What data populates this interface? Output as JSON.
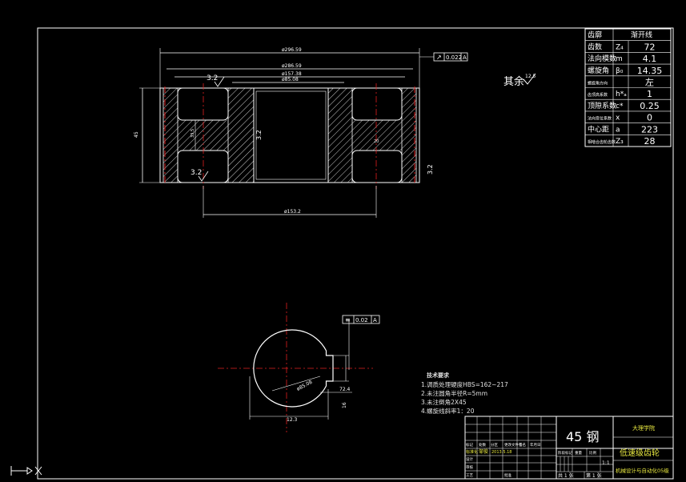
{
  "params_table": {
    "rows": [
      {
        "label": "齿廓",
        "symbol": "",
        "value": "渐开线"
      },
      {
        "label": "齿数",
        "symbol": "Z₄",
        "value": "72"
      },
      {
        "label": "法向模数",
        "symbol": "m",
        "value": "4.1"
      },
      {
        "label": "螺旋角",
        "symbol": "β₀",
        "value": "14.35"
      },
      {
        "label": "螺旋角方向",
        "symbol": "",
        "value": "左"
      },
      {
        "label": "齿顶高系数",
        "symbol": "h*ₐ",
        "value": "1"
      },
      {
        "label": "顶隙系数",
        "symbol": "c*",
        "value": "0.25"
      },
      {
        "label": "法向变位系数",
        "symbol": "x",
        "value": "0"
      },
      {
        "label": "中心距",
        "symbol": "a",
        "value": "223"
      },
      {
        "label": "相啮合齿轮齿数",
        "symbol": "Z₃",
        "value": "28"
      }
    ]
  },
  "surface_note": {
    "text": "其余",
    "roughness": "12.5"
  },
  "section_view": {
    "dims": {
      "top_outer": "ø296.59",
      "top_second": "ø286.59",
      "top_third": "ø157.38",
      "top_bore": "ø85.08",
      "bottom": "ø153.2",
      "left_height": "45",
      "web_depth": "33.5",
      "hub": "20"
    },
    "tolerance_top": {
      "symbol": "↗",
      "value": "0.022",
      "datum": "A"
    },
    "roughness": [
      "3.2",
      "3.2",
      "3.2",
      "3.2"
    ]
  },
  "end_view": {
    "tolerance": {
      "symbol": "≡",
      "value": "0.02",
      "datum": "A"
    },
    "dims": {
      "diameter": "ø85.08",
      "keyway": "72.4",
      "width": "12.3",
      "key": "16"
    }
  },
  "tech_requirements": {
    "title": "技术要求",
    "items": [
      "1.调质处理硬度HBS=162~217",
      "2.未注圆角半径R=5mm",
      "3.未注倒角2X45",
      "4.螺旋线斜率1：20"
    ]
  },
  "title_block": {
    "material": "45 钢",
    "school": "大理学院",
    "part_name": "低速级齿轮",
    "project": "机械设计与自动化05级",
    "scale": "1:1",
    "sheet_total": "共 1 张",
    "sheet_num": "第 1 张",
    "designer": "邹俊",
    "date": "2013.5.18",
    "std": "标准化",
    "cells": [
      "标记",
      "处数",
      "分区",
      "更改文件号",
      "签名",
      "年月日",
      "设计",
      "审核",
      "工艺",
      "批准",
      "阶段标记",
      "重量",
      "比例"
    ]
  }
}
